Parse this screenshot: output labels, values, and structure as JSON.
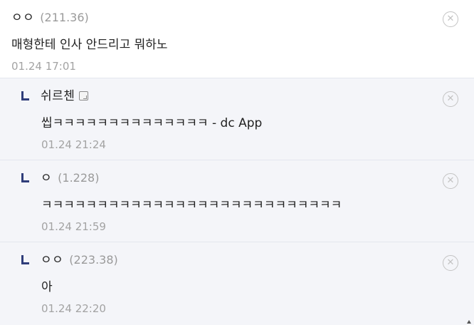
{
  "comments": [
    {
      "nickname": "ㅇㅇ",
      "ip": "(211.36)",
      "text": "매형한테 인사 안드리고 뭐하노",
      "time": "01.24 17:01"
    }
  ],
  "replies": [
    {
      "nickname": "쉬르첸",
      "ip": "",
      "text": "씹ㅋㅋㅋㅋㅋㅋㅋㅋㅋㅋㅋㅋㅋㅋ - dc App",
      "time": "01.24 21:24"
    },
    {
      "nickname": "ㅇ",
      "ip": "(1.228)",
      "text": "ㅋㅋㅋㅋㅋㅋㅋㅋㅋㅋㅋㅋㅋㅋㅋㅋㅋㅋㅋㅋㅋㅋㅋㅋㅋㅋㅋ",
      "time": "01.24 21:59"
    },
    {
      "nickname": "ㅇㅇ",
      "ip": "(223.38)",
      "text": "아",
      "time": "01.24 22:20"
    }
  ],
  "icons": {
    "delete": "close-circle-icon",
    "reply_marker": "reply-arrow-icon",
    "fixed_nick": "fixed-nickname-icon"
  },
  "colors": {
    "reply_background": "#f4f5f9",
    "reply_marker": "#2f3d7a",
    "ip_text": "#9a9a9a"
  }
}
